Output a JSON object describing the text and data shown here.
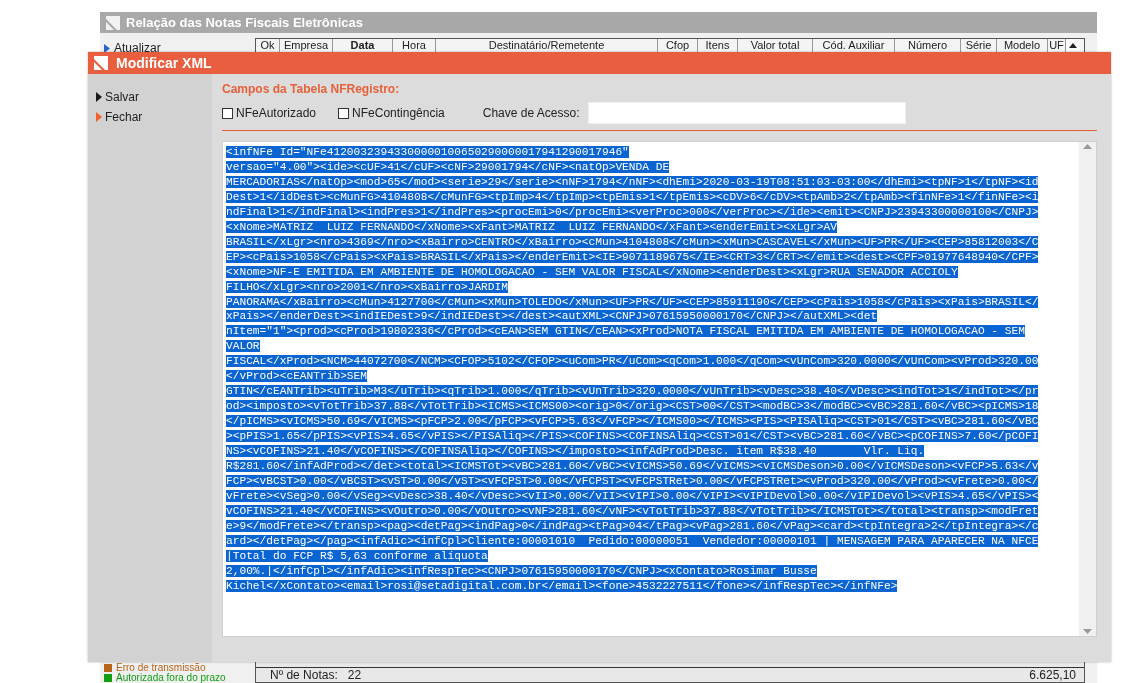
{
  "background_window": {
    "title": "Relação das Notas Fiscais Eletrônicas",
    "sidebar": {
      "items": [
        {
          "label": "Atualizar"
        }
      ]
    },
    "table": {
      "columns": [
        "Ok",
        "Empresa",
        "Data",
        "Hora",
        "Destinatário/Remetente",
        "Cfop",
        "Itens",
        "Valor total",
        "Cód. Auxiliar",
        "Número",
        "Série",
        "Modelo",
        "UF"
      ]
    },
    "legend": [
      {
        "label": "Erro de transmissão",
        "color": "#b8651b"
      },
      {
        "label": "Autorizada fora do prazo",
        "color": "#119e11"
      }
    ],
    "footer": {
      "count_label": "Nº de Notas:",
      "count": "22",
      "total": "6.625,10"
    }
  },
  "dialog": {
    "title": "Modificar XML",
    "actions": [
      {
        "label": "Salvar",
        "color": "#1a1a1a"
      },
      {
        "label": "Fechar",
        "color": "#f0602a"
      }
    ],
    "section_title": "Campos da Tabela NFRegistro:",
    "checkboxes": [
      {
        "label": "NFeAutorizado",
        "checked": false
      },
      {
        "label": "NFeContingência",
        "checked": false
      }
    ],
    "access_key": {
      "label": "Chave de Acesso:"
    },
    "xml_editor": {
      "selected": true,
      "lines": [
        "<infNFe Id=\"NFe41200323943300000100650290000017941290017946\"",
        "versao=\"4.00\"><ide><cUF>41</cUF><cNF>29001794</cNF><natOp>VENDA DE",
        "MERCADORIAS</natOp><mod>65</mod><serie>29</serie><nNF>1794</nNF><dhEmi>2020-03-19T08:51:03-03:00</dhEmi><tpNF>1</tpNF><id",
        "Dest>1</idDest><cMunFG>4104808</cMunFG><tpImp>4</tpImp><tpEmis>1</tpEmis><cDV>6</cDV><tpAmb>2</tpAmb><finNFe>1</finNFe><i",
        "ndFinal>1</indFinal><indPres>1</indPres><procEmi>0</procEmi><verProc>000</verProc></ide><emit><CNPJ>23943300000100</CNPJ>",
        "<xNome>MATRIZ  LUIZ FERNANDO</xNome><xFant>MATRIZ  LUIZ FERNANDO</xFant><enderEmit><xLgr>AV",
        "BRASIL</xLgr><nro>4369</nro><xBairro>CENTRO</xBairro><cMun>4104808</cMun><xMun>CASCAVEL</xMun><UF>PR</UF><CEP>85812003</C",
        "EP><cPais>1058</cPais><xPais>BRASIL</xPais></enderEmit><IE>9071189675</IE><CRT>3</CRT></emit><dest><CPF>01977648940</CPF>",
        "<xNome>NF-E EMITIDA EM AMBIENTE DE HOMOLOGACAO - SEM VALOR FISCAL</xNome><enderDest><xLgr>RUA SENADOR ACCIOLY",
        "FILHO</xLgr><nro>2001</nro><xBairro>JARDIM",
        "PANORAMA</xBairro><cMun>4127700</cMun><xMun>TOLEDO</xMun><UF>PR</UF><CEP>85911190</CEP><cPais>1058</cPais><xPais>BRASIL</",
        "xPais></enderDest><indIEDest>9</indIEDest></dest><autXML><CNPJ>07615950000170</CNPJ></autXML><det",
        "nItem=\"1\"><prod><cProd>19802336</cProd><cEAN>SEM GTIN</cEAN><xProd>NOTA FISCAL EMITIDA EM AMBIENTE DE HOMOLOGACAO - SEM",
        "VALOR",
        "FISCAL</xProd><NCM>44072700</NCM><CFOP>5102</CFOP><uCom>PR</uCom><qCom>1.000</qCom><vUnCom>320.0000</vUnCom><vProd>320.00",
        "</vProd><cEANTrib>SEM",
        "GTIN</cEANTrib><uTrib>M3</uTrib><qTrib>1.000</qTrib><vUnTrib>320.0000</vUnTrib><vDesc>38.40</vDesc><indTot>1</indTot></pr",
        "od><imposto><vTotTrib>37.88</vTotTrib><ICMS><ICMS00><orig>0</orig><CST>00</CST><modBC>3</modBC><vBC>281.60</vBC><pICMS>18",
        "</pICMS><vICMS>50.69</vICMS><pFCP>2.00</pFCP><vFCP>5.63</vFCP></ICMS00></ICMS><PIS><PISAliq><CST>01</CST><vBC>281.60</vBC",
        "><pPIS>1.65</pPIS><vPIS>4.65</vPIS></PISAliq></PIS><COFINS><COFINSAliq><CST>01</CST><vBC>281.60</vBC><pCOFINS>7.60</pCOFI",
        "NS><vCOFINS>21.40</vCOFINS></COFINSAliq></COFINS></imposto><infAdProd>Desc. item R$38.40       Vlr. Liq.",
        "R$281.60</infAdProd></det><total><ICMSTot><vBC>281.60</vBC><vICMS>50.69</vICMS><vICMSDeson>0.00</vICMSDeson><vFCP>5.63</v",
        "FCP><vBCST>0.00</vBCST><vST>0.00</vST><vFCPST>0.00</vFCPST><vFCPSTRet>0.00</vFCPSTRet><vProd>320.00</vProd><vFrete>0.00</",
        "vFrete><vSeg>0.00</vSeg><vDesc>38.40</vDesc><vII>0.00</vII><vIPI>0.00</vIPI><vIPIDevol>0.00</vIPIDevol><vPIS>4.65</vPIS><",
        "vCOFINS>21.40</vCOFINS><vOutro>0.00</vOutro><vNF>281.60</vNF><vTotTrib>37.88</vTotTrib></ICMSTot></total><transp><modFret",
        "e>9</modFrete></transp><pag><detPag><indPag>0</indPag><tPag>04</tPag><vPag>281.60</vPag><card><tpIntegra>2</tpIntegra></c",
        "ard></detPag></pag><infAdic><infCpl>Cliente:00001010  Pedido:00000051  Vendedor:00000101 | MENSAGEM PARA APARECER NA NFCE",
        "|Total do FCP R$ 5,63 conforme alíquota",
        "2,00%.|</infCpl></infAdic><infRespTec><CNPJ>07615950000170</CNPJ><xContato>Rosimar Busse",
        "Kichel</xContato><email>rosi@setadigital.com.br</email><fone>4532227511</fone></infRespTec></infNFe>"
      ]
    }
  }
}
